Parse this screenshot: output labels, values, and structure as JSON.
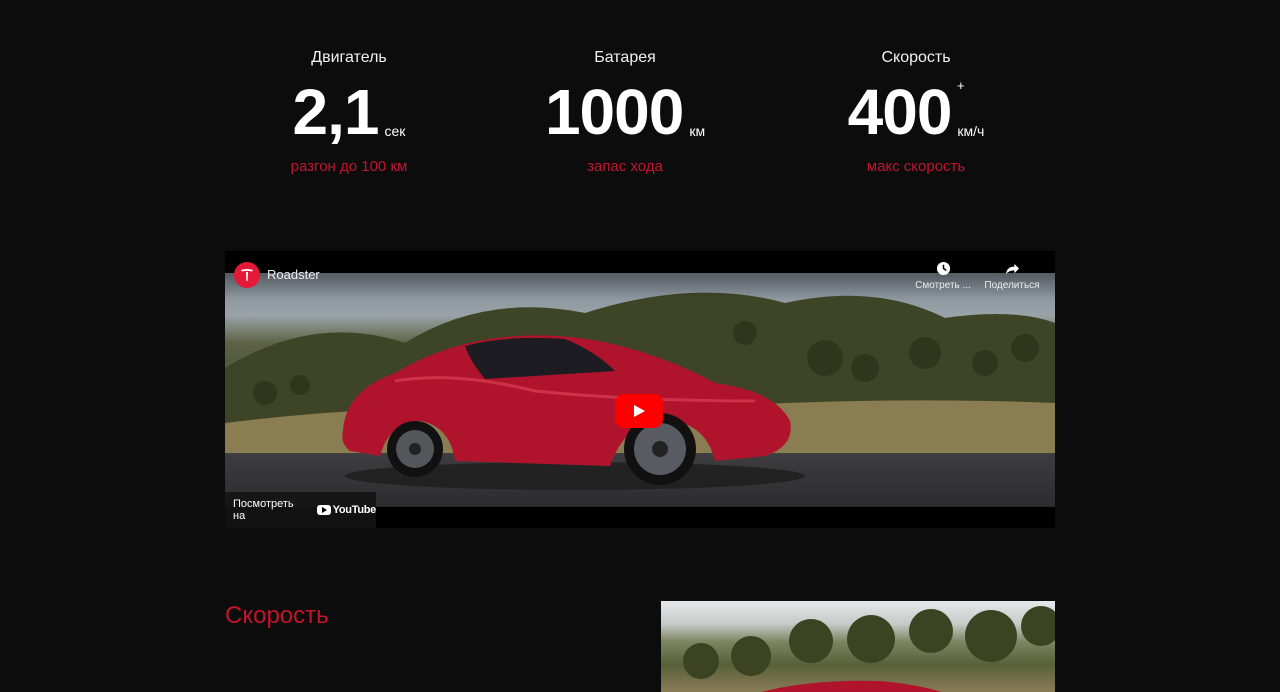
{
  "stats": [
    {
      "label": "Двигатель",
      "value": "2,1",
      "unit": "сек",
      "plus": "",
      "caption": "разгон до 100 км"
    },
    {
      "label": "Батарея",
      "value": "1000",
      "unit": "км",
      "plus": "",
      "caption": "запас хода"
    },
    {
      "label": "Скорость",
      "value": "400",
      "unit": "км/ч",
      "plus": "+",
      "caption": "макс скорость"
    }
  ],
  "video": {
    "title": "Roadster",
    "channel_icon": "tesla-logo-icon",
    "watch_later_label": "Смотреть ...",
    "share_label": "Поделиться",
    "watch_on_label": "Посмотреть на",
    "youtube_label": "YouTube"
  },
  "section": {
    "heading": "Скорость"
  },
  "colors": {
    "background": "#0c0c0d",
    "accent": "#c3142c",
    "youtube_red": "#ff0000"
  }
}
